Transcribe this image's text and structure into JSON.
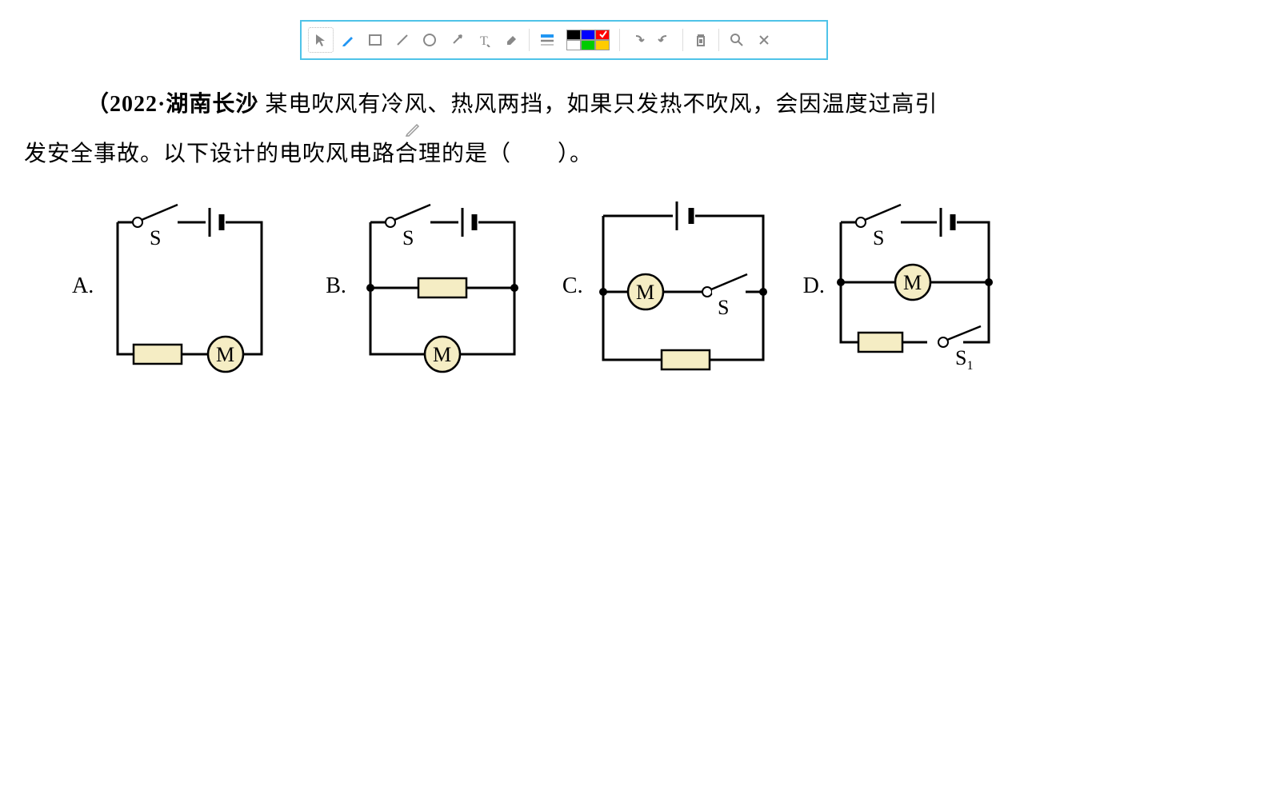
{
  "toolbar": {
    "colors": [
      "#000000",
      "#0000ff",
      "#ff0000",
      "#ffffff",
      "#00cc00",
      "#ffcc00"
    ]
  },
  "question": {
    "source_prefix": "（",
    "source": "2022·湖南长沙",
    "line1_rest": " 某电吹风有冷风、热风两挡，如果只发热不吹风，会因温度过高引",
    "line2": "发安全事故。以下设计的电吹风电路合理的是（　　）。"
  },
  "options": {
    "a": "A.",
    "b": "B.",
    "c": "C.",
    "d": "D."
  },
  "labels": {
    "switch": "S",
    "switch1": "S",
    "switch1_sub": "1",
    "motor": "M"
  }
}
